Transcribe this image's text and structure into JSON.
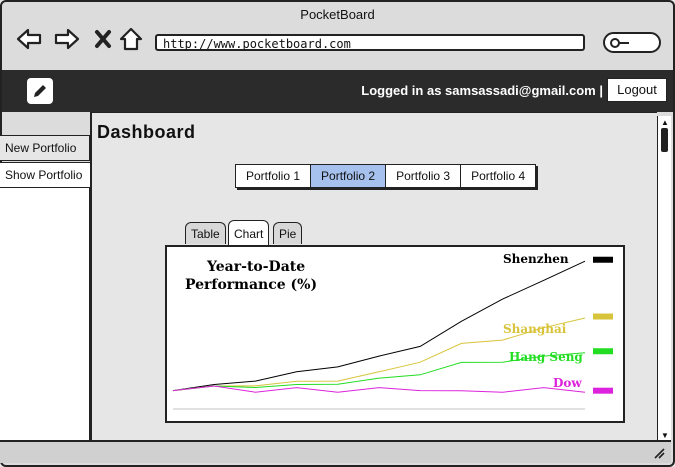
{
  "window": {
    "title": "PocketBoard"
  },
  "browser": {
    "url": "http://www.pocketboard.com"
  },
  "header": {
    "login_text": "Logged in as samsassadi@gmail.com |",
    "logout_label": "Logout"
  },
  "sidebar": {
    "items": [
      {
        "label": "New Portfolio"
      },
      {
        "label": "Show Portfolio"
      }
    ]
  },
  "main": {
    "title": "Dashboard",
    "portfolio_tabs": [
      "Portfolio 1",
      "Portfolio 2",
      "Portfolio 3",
      "Portfolio 4"
    ],
    "active_portfolio": "Portfolio 2",
    "view_tabs": [
      "Table",
      "Chart",
      "Pie"
    ],
    "active_view": "Chart"
  },
  "colors": {
    "accent": "#a6c1ee",
    "header_bg": "#2b2b2b"
  },
  "chart_data": {
    "type": "line",
    "title": "Year-to-Date Performance (%)",
    "series": [
      {
        "name": "Shenzhen",
        "color": "#000000",
        "values": [
          0,
          2,
          6,
          10,
          15,
          20,
          28,
          42,
          58,
          68,
          82
        ]
      },
      {
        "name": "Shanghai",
        "color": "#d8c43a",
        "values": [
          0,
          1,
          3,
          4,
          6,
          10,
          18,
          28,
          32,
          38,
          46
        ]
      },
      {
        "name": "Hang Seng",
        "color": "#22dd22",
        "values": [
          0,
          1,
          2,
          2,
          4,
          6,
          10,
          16,
          18,
          20,
          24
        ]
      },
      {
        "name": "Dow",
        "color": "#dd22dd",
        "values": [
          0,
          1,
          -1,
          0,
          -1,
          0,
          0,
          -2,
          -1,
          0,
          -1
        ]
      }
    ]
  }
}
